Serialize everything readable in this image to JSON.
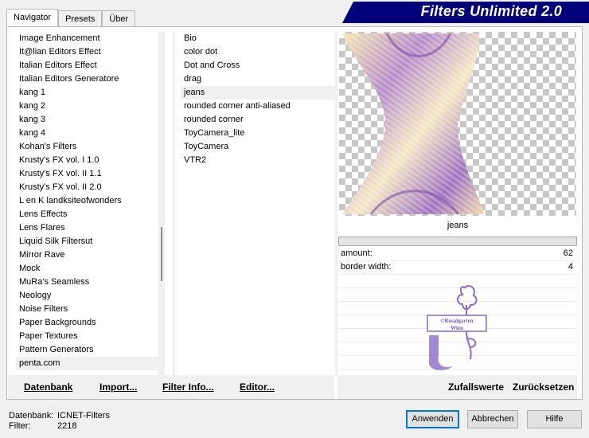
{
  "banner": {
    "title": "Filters Unlimited 2.0"
  },
  "tabs": [
    {
      "label": "Navigator",
      "active": true
    },
    {
      "label": "Presets",
      "active": false
    },
    {
      "label": "Über",
      "active": false
    }
  ],
  "categories": [
    "Image Enhancement",
    "It@lian Editors Effect",
    "Italian Editors Effect",
    "Italian Editors Generatore",
    "kang 1",
    "kang 2",
    "kang 3",
    "kang 4",
    "Kohan's Filters",
    "Krusty's FX vol. I 1.0",
    "Krusty's FX vol. II 1.1",
    "Krusty's FX vol. II 2.0",
    "L en K landksiteofwonders",
    "Lens Effects",
    "Lens Flares",
    "Liquid Silk Filtersut",
    "Mirror Rave",
    "Mock",
    "MuRa's Seamless",
    "Neology",
    "Noise Filters",
    "Paper Backgrounds",
    "Paper Textures",
    "Pattern Generators",
    "penta.com"
  ],
  "selected_category": "penta.com",
  "filters": [
    "Bio",
    "color dot",
    "Dot and Cross",
    "drag",
    "jeans",
    "rounded corner anti-aliased",
    "rounded corner",
    "ToyCamera_lite",
    "ToyCamera",
    "VTR2"
  ],
  "selected_filter": "jeans",
  "filter_name": "jeans",
  "params": [
    {
      "label": "amount:",
      "value": "62"
    },
    {
      "label": "border width:",
      "value": "4"
    }
  ],
  "watermark_text": [
    "©Rosalgarten",
    "Wien"
  ],
  "bottom_left": {
    "database": "Datenbank",
    "import": "Import...",
    "filter_info": "Filter Info...",
    "editor": "Editor..."
  },
  "bottom_right": {
    "random": "Zufallswerte",
    "reset": "Zurücksetzen"
  },
  "footer": {
    "db_label": "Datenbank:",
    "db_value": "ICNET-Filters",
    "filter_label": "Filter:",
    "filter_value": "2218"
  },
  "buttons": {
    "apply": "Anwenden",
    "cancel": "Abbrechen",
    "help": "Hilfe"
  },
  "colors": {
    "banner": "#00007b",
    "accent": "#0078d7",
    "selection": "#f0f0f0"
  }
}
